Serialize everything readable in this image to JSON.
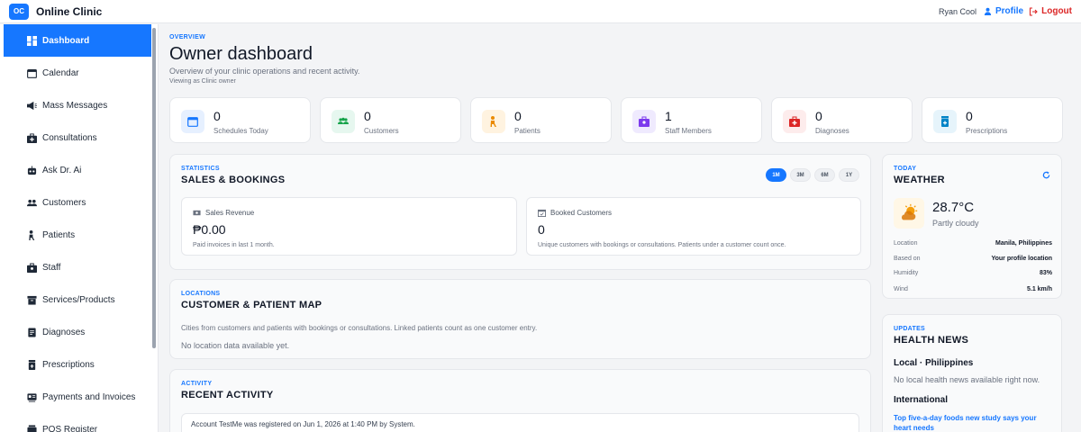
{
  "app": {
    "logo_text": "OC",
    "title": "Online Clinic"
  },
  "topbar": {
    "user_name": "Ryan Cool",
    "profile_label": "Profile",
    "logout_label": "Logout"
  },
  "sidebar": {
    "items": [
      {
        "label": "Dashboard",
        "icon": "dashboard-icon",
        "active": true
      },
      {
        "label": "Calendar",
        "icon": "calendar-icon"
      },
      {
        "label": "Mass Messages",
        "icon": "megaphone-icon"
      },
      {
        "label": "Consultations",
        "icon": "medkit-icon"
      },
      {
        "label": "Ask Dr. Ai",
        "icon": "robot-icon"
      },
      {
        "label": "Customers",
        "icon": "users-icon"
      },
      {
        "label": "Patients",
        "icon": "patient-icon"
      },
      {
        "label": "Staff",
        "icon": "staff-icon"
      },
      {
        "label": "Services/Products",
        "icon": "box-icon"
      },
      {
        "label": "Diagnoses",
        "icon": "file-icon"
      },
      {
        "label": "Prescriptions",
        "icon": "prescription-icon"
      },
      {
        "label": "Payments and Invoices",
        "icon": "invoice-icon"
      },
      {
        "label": "POS Register",
        "icon": "register-icon"
      }
    ]
  },
  "overview": {
    "eyebrow": "OVERVIEW",
    "title": "Owner dashboard",
    "subtitle": "Overview of your clinic operations and recent activity.",
    "viewing_as": "Viewing as Clinic owner"
  },
  "stats": [
    {
      "value": "0",
      "label": "Schedules Today",
      "icon": "calendar-icon",
      "bg": "#e6f0ff",
      "fg": "#1677ff"
    },
    {
      "value": "0",
      "label": "Customers",
      "icon": "users-icon",
      "bg": "#e6f7ef",
      "fg": "#16a34a"
    },
    {
      "value": "0",
      "label": "Patients",
      "icon": "patient-icon",
      "bg": "#fff3e0",
      "fg": "#ea8a00"
    },
    {
      "value": "1",
      "label": "Staff Members",
      "icon": "staff-icon",
      "bg": "#efeafe",
      "fg": "#7c3aed"
    },
    {
      "value": "0",
      "label": "Diagnoses",
      "icon": "medkit-icon",
      "bg": "#fdecec",
      "fg": "#dc2626"
    },
    {
      "value": "0",
      "label": "Prescriptions",
      "icon": "prescription-icon",
      "bg": "#e6f4fb",
      "fg": "#0284c7"
    }
  ],
  "sales": {
    "eyebrow": "STATISTICS",
    "title": "SALES & BOOKINGS",
    "ranges": [
      "1M",
      "3M",
      "6M",
      "1Y"
    ],
    "active_range": "1M",
    "revenue": {
      "label": "Sales Revenue",
      "value": "₱0.00",
      "note": "Paid invoices in last 1 month."
    },
    "booked": {
      "label": "Booked Customers",
      "value": "0",
      "note": "Unique customers with bookings or consultations. Patients under a customer count once."
    }
  },
  "map": {
    "eyebrow": "LOCATIONS",
    "title": "CUSTOMER & PATIENT MAP",
    "description": "Cities from customers and patients with bookings or consultations. Linked patients count as one customer entry.",
    "empty": "No location data available yet."
  },
  "activity": {
    "eyebrow": "ACTIVITY",
    "title": "RECENT ACTIVITY",
    "items": [
      "Account TestMe was registered on Jun 1, 2026 at 1:40 PM by System."
    ]
  },
  "weather": {
    "eyebrow": "TODAY",
    "title": "WEATHER",
    "temperature": "28.7°C",
    "condition": "Partly cloudy",
    "rows": [
      {
        "key": "Location",
        "value": "Manila, Philippines"
      },
      {
        "key": "Based on",
        "value": "Your profile location"
      },
      {
        "key": "Humidity",
        "value": "83%"
      },
      {
        "key": "Wind",
        "value": "5.1 km/h"
      }
    ]
  },
  "news": {
    "eyebrow": "UPDATES",
    "title": "HEALTH NEWS",
    "local_heading": "Local · Philippines",
    "local_empty": "No local health news available right now.",
    "intl_heading": "International",
    "intl_item": "Top five-a-day foods new study says your heart needs"
  }
}
